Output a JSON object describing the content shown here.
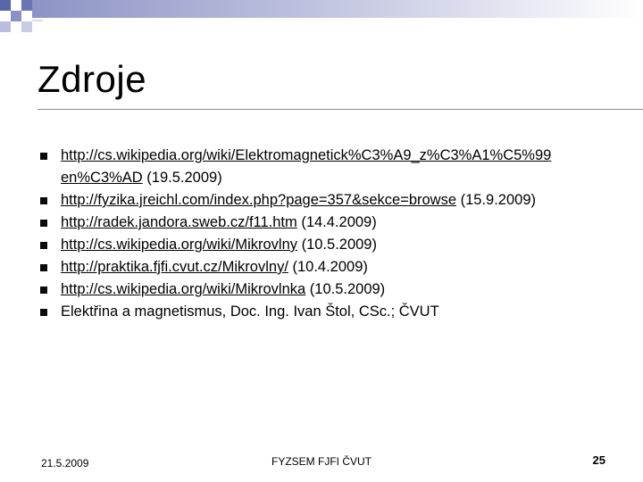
{
  "slide": {
    "title": "Zdroje",
    "items": [
      {
        "link": "http://cs.wikipedia.org/wiki/Elektromagnetick%C3%A9_z%C3%A1%C5%99 en%C3%AD",
        "note": " (19.5.2009)"
      },
      {
        "link": "http://fyzika.jreichl.com/index.php?page=357&sekce=browse",
        "note": " (15.9.2009)"
      },
      {
        "link": "http://radek.jandora.sweb.cz/f11.htm",
        "note": " (14.4.2009)"
      },
      {
        "link": "http://cs.wikipedia.org/wiki/Mikrovlny",
        "note": " (10.5.2009)"
      },
      {
        "link": "http://praktika.fjfi.cvut.cz/Mikrovlny/",
        "note": " (10.4.2009)"
      },
      {
        "link": "http://cs.wikipedia.org/wiki/Mikrovlnka",
        "note": " (10.5.2009)"
      },
      {
        "text": "Elektřina a magnetismus, Doc. Ing. Ivan Štol, CSc.; ČVUT"
      }
    ]
  },
  "footer": {
    "date": "21.5.2009",
    "center": "FYZSEM FJFI ČVUT",
    "page": "25"
  },
  "colors": {
    "decor_dark": "#5a64a8",
    "decor_light": "#c7cbe3",
    "bullet": "#0a0a0a"
  }
}
